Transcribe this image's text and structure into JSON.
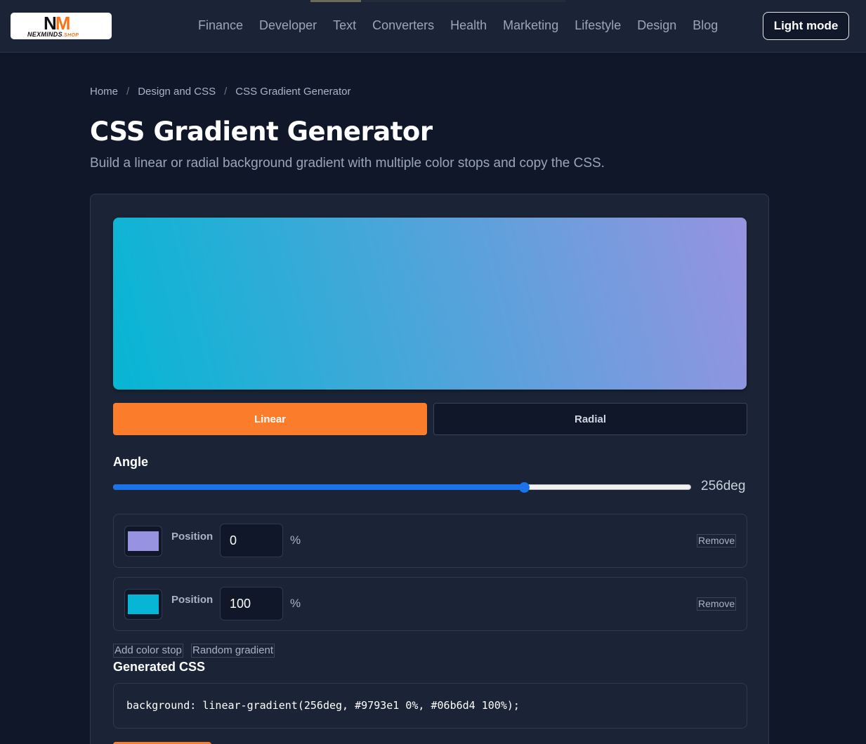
{
  "header": {
    "logo": {
      "mark": "NM",
      "name": "NEXMINDS",
      "suffix": ".SHOP"
    },
    "nav": [
      "Finance",
      "Developer",
      "Text",
      "Converters",
      "Health",
      "Marketing",
      "Lifestyle",
      "Design",
      "Blog"
    ],
    "theme_button": "Light mode"
  },
  "breadcrumb": {
    "home": "Home",
    "category": "Design and CSS",
    "current": "CSS Gradient Generator",
    "separator": "/"
  },
  "page": {
    "title": "CSS Gradient Generator",
    "subtitle": "Build a linear or radial background gradient with multiple color stops and copy the CSS."
  },
  "controls": {
    "types": [
      "Linear",
      "Radial"
    ],
    "selected_type": "Linear",
    "angle_label": "Angle",
    "angle_value": "256deg",
    "angle_deg": 256,
    "angle_max": 360
  },
  "stops": [
    {
      "color": "#9793e1",
      "position_label": "Position",
      "position": "0",
      "unit": "%",
      "remove_label": "Remove"
    },
    {
      "color": "#06b6d4",
      "position_label": "Position",
      "position": "100",
      "unit": "%",
      "remove_label": "Remove"
    }
  ],
  "actions": {
    "add_stop": "Add color stop",
    "random": "Random gradient"
  },
  "output": {
    "label": "Generated CSS",
    "css": "background: linear-gradient(256deg, #9793e1 0%, #06b6d4 100%);"
  },
  "colors": {
    "accent": "#fb7d2c",
    "slider": "#1a73e8",
    "page_bg": "#0f1729",
    "card_bg": "#1b2436"
  }
}
